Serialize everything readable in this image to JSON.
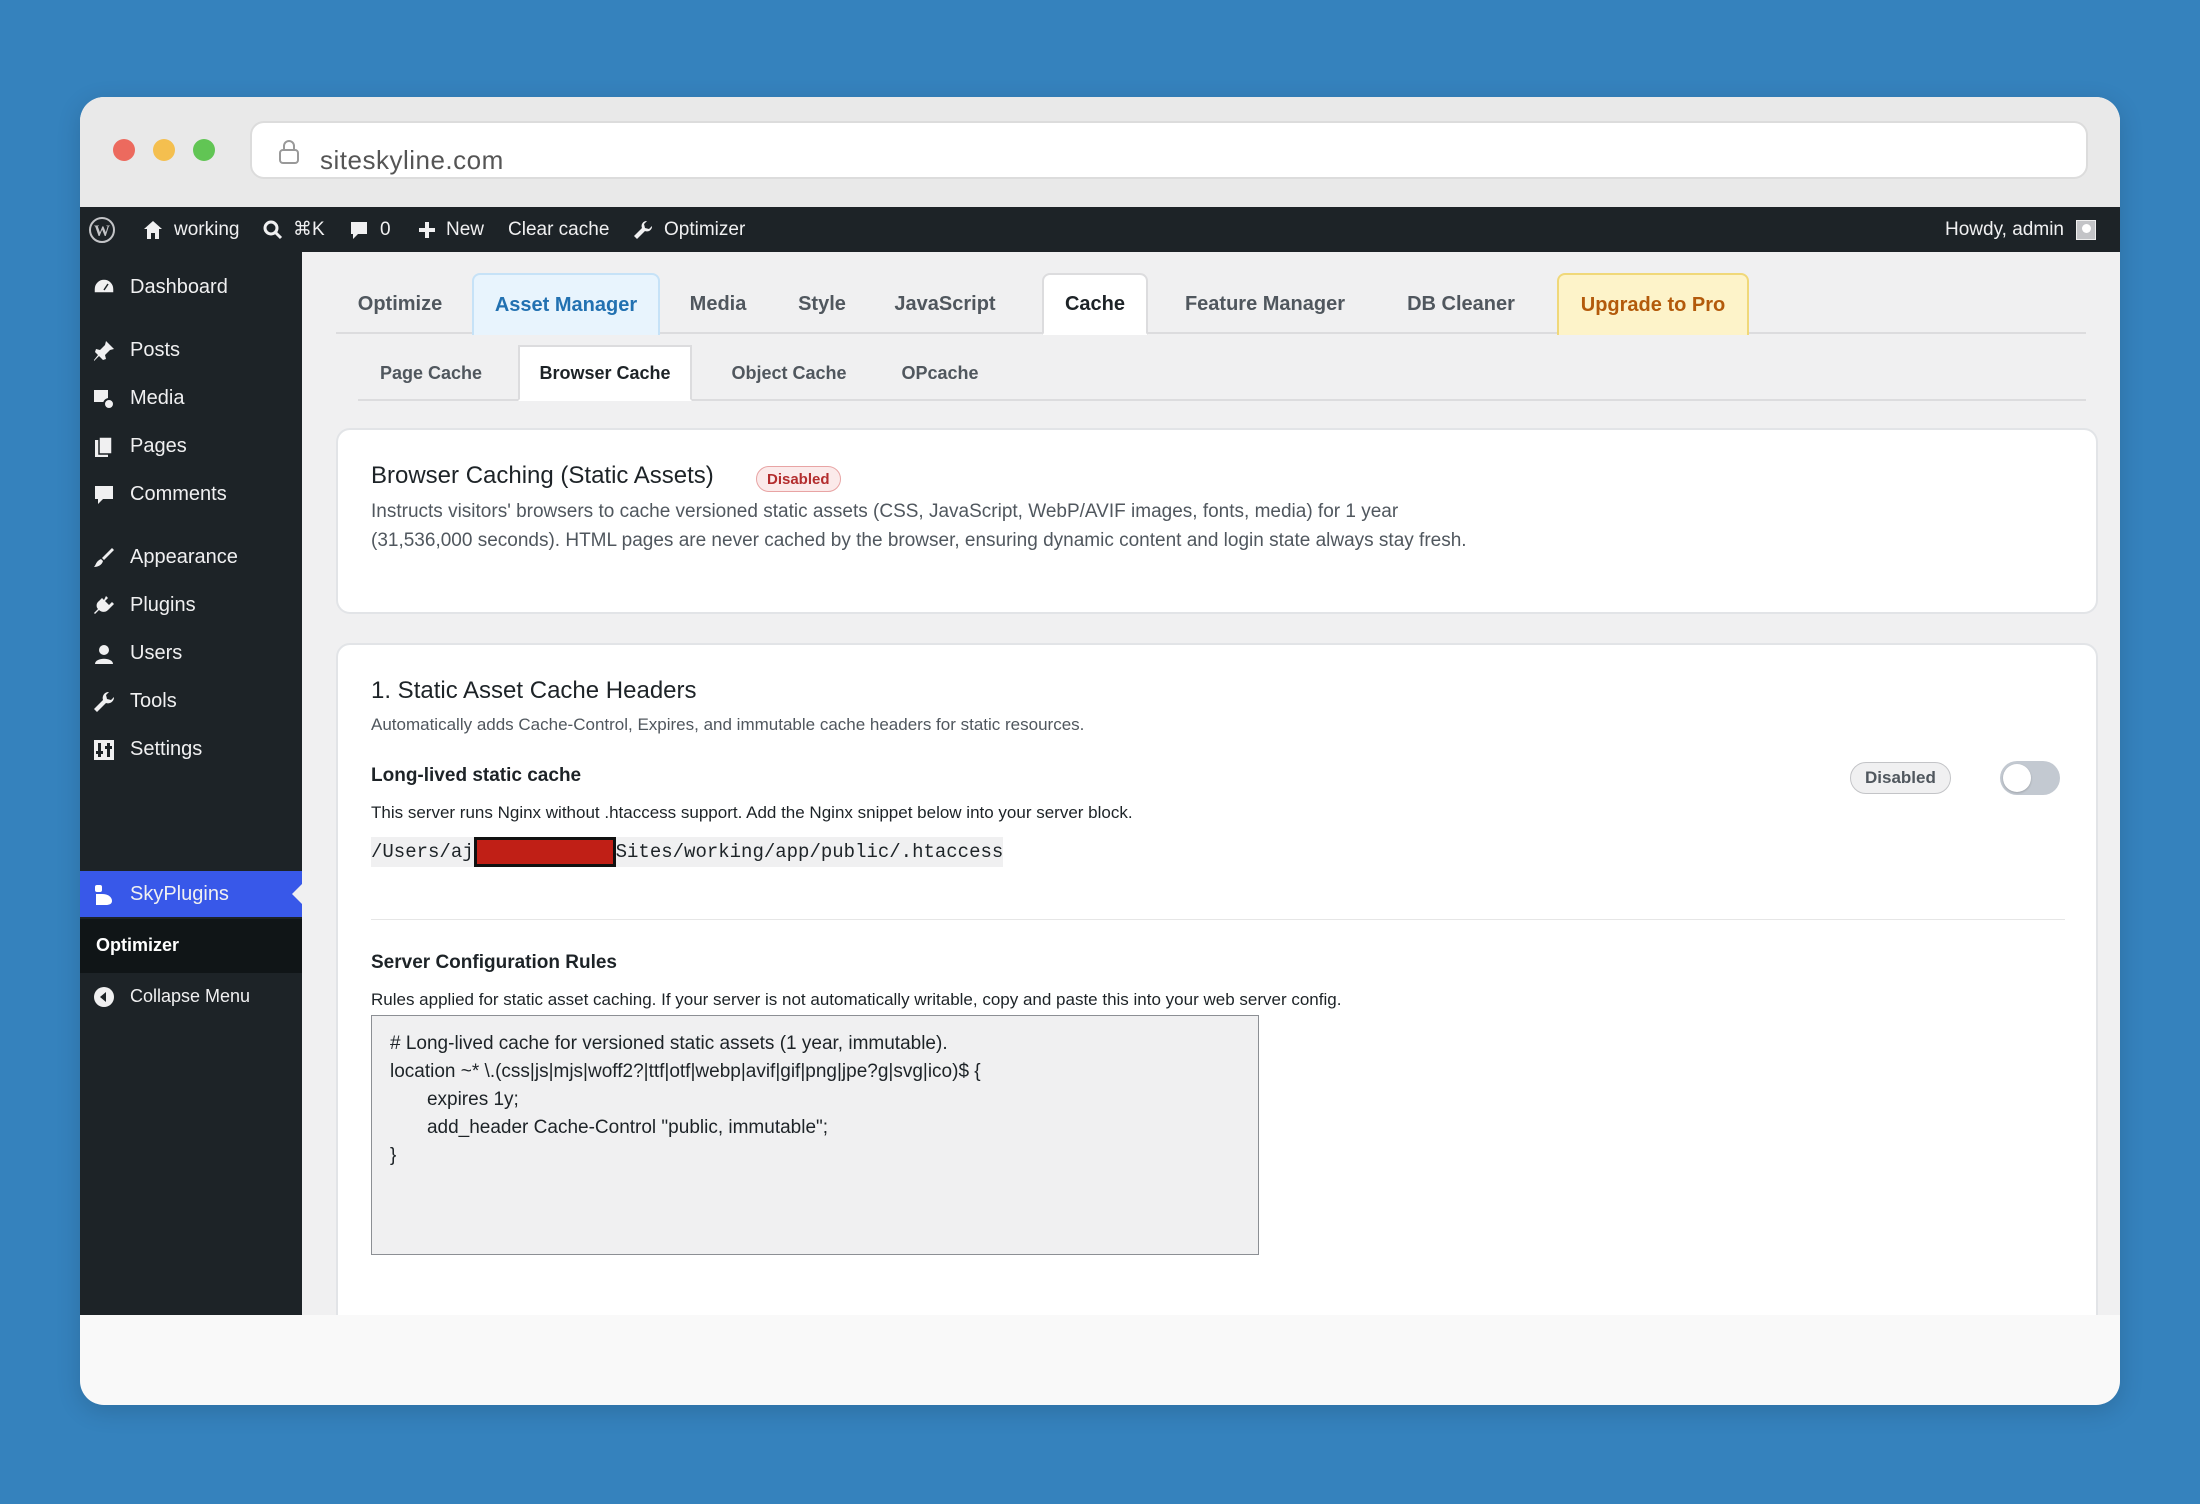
{
  "browser": {
    "url": "siteskyline.com"
  },
  "adminbar": {
    "site": "working",
    "shortcut": "⌘K",
    "comments": "0",
    "new": "New",
    "clear_cache": "Clear cache",
    "optimizer": "Optimizer",
    "howdy": "Howdy, admin"
  },
  "sidebar": {
    "items": [
      {
        "label": "Dashboard",
        "icon": "dashboard-icon"
      },
      {
        "label": "Posts",
        "icon": "pin-icon"
      },
      {
        "label": "Media",
        "icon": "media-icon"
      },
      {
        "label": "Pages",
        "icon": "pages-icon"
      },
      {
        "label": "Comments",
        "icon": "comment-icon"
      },
      {
        "label": "Appearance",
        "icon": "brush-icon"
      },
      {
        "label": "Plugins",
        "icon": "plug-icon"
      },
      {
        "label": "Users",
        "icon": "user-icon"
      },
      {
        "label": "Tools",
        "icon": "wrench-icon"
      },
      {
        "label": "Settings",
        "icon": "settings-icon"
      },
      {
        "label": "SkyPlugins",
        "icon": "skyplugins-icon"
      }
    ],
    "submenu_item": "Optimizer",
    "collapse": "Collapse Menu"
  },
  "tabs": [
    "Optimize",
    "Asset Manager",
    "Media",
    "Style",
    "JavaScript",
    "Cache",
    "Feature Manager",
    "DB Cleaner",
    "Upgrade to Pro"
  ],
  "subtabs": [
    "Page Cache",
    "Browser Cache",
    "Object Cache",
    "OPcache"
  ],
  "intro": {
    "title": "Browser Caching (Static Assets)",
    "badge": "Disabled",
    "desc_line1": "Instructs visitors' browsers to cache versioned static assets (CSS, JavaScript, WebP/AVIF images, fonts, media) for 1 year",
    "desc_line2": "(31,536,000 seconds). HTML pages are never cached by the browser, ensuring dynamic content and login state always stay fresh."
  },
  "section1": {
    "title": "1. Static Asset Cache Headers",
    "desc": "Automatically adds Cache-Control, Expires, and immutable cache headers for static resources.",
    "option_label": "Long-lived static cache",
    "status_pill": "Disabled",
    "toggle_on": false,
    "server_note": "This server runs Nginx without .htaccess support. Add the Nginx snippet below into your server block.",
    "path_prefix": "/Users/aj",
    "path_suffix": "Sites/working/app/public/.htaccess",
    "rules_title": "Server Configuration Rules",
    "rules_desc": "Rules applied for static asset caching. If your server is not automatically writable, copy and paste this into your web server config.",
    "rules_code": "# Long-lived cache for versioned static assets (1 year, immutable).\nlocation ~* \\.(css|js|mjs|woff2?|ttf|otf|webp|avif|gif|png|jpe?g|svg|ico)$ {\n       expires 1y;\n       add_header Cache-Control \"public, immutable\";\n}"
  }
}
